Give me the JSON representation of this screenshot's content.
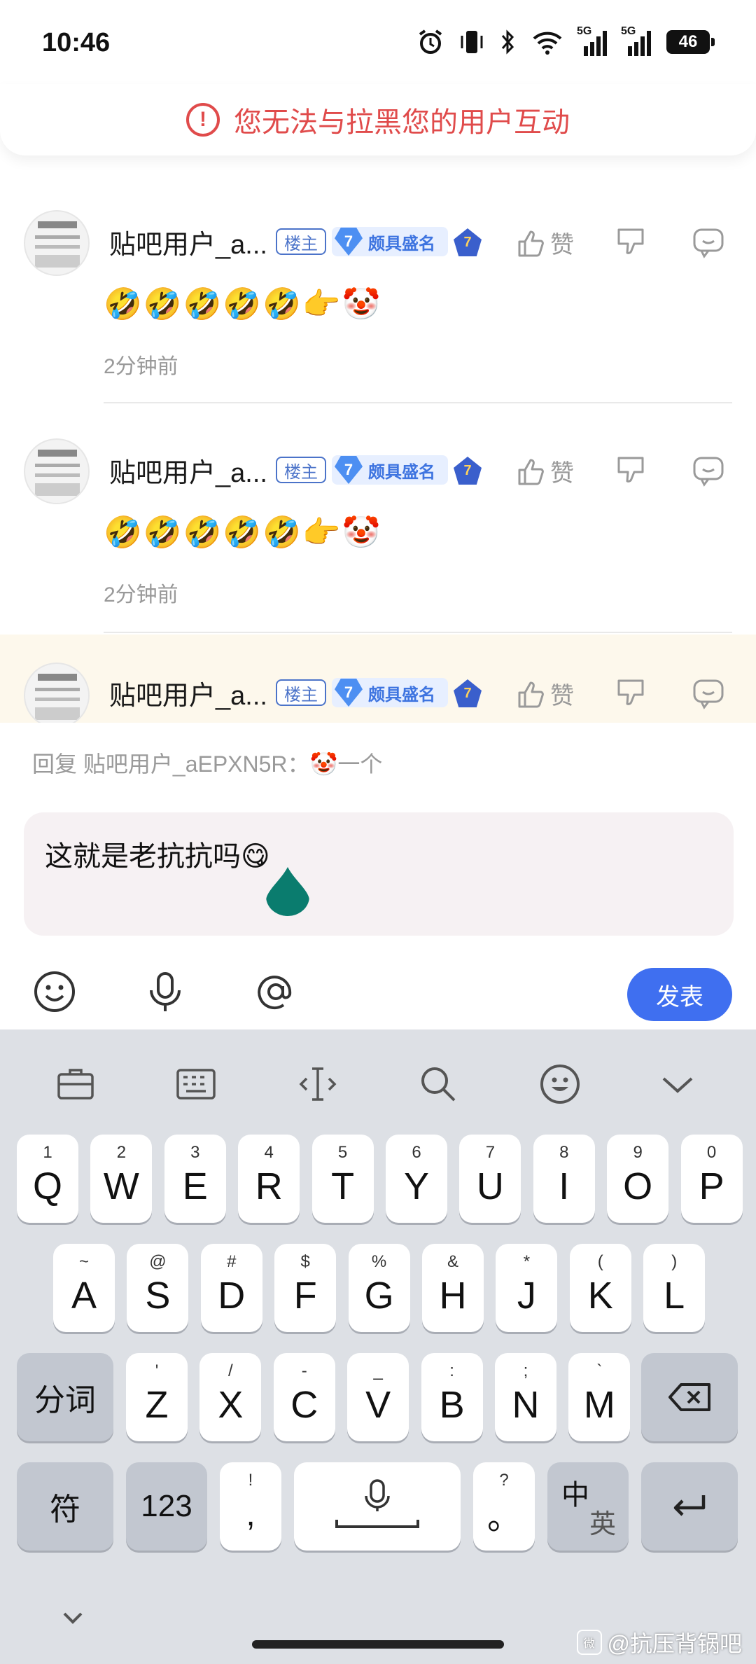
{
  "status_bar": {
    "time": "10:46",
    "network_1": "5G",
    "network_2": "5G",
    "battery": "46"
  },
  "banner": {
    "icon": "exclamation-circle-icon",
    "text": "您无法与拉黑您的用户互动",
    "color": "#e04b4b"
  },
  "comments": [
    {
      "username": "贴吧用户_a...",
      "host_tag": "楼主",
      "level": "7",
      "level_title": "颇具盛名",
      "medal": "7",
      "like_label": "赞",
      "body": "🤣🤣🤣🤣🤣👉🤡",
      "time": "2分钟前"
    },
    {
      "username": "贴吧用户_a...",
      "host_tag": "楼主",
      "level": "7",
      "level_title": "颇具盛名",
      "medal": "7",
      "like_label": "赞",
      "body": "🤣🤣🤣🤣🤣👉🤡",
      "time": "2分钟前"
    },
    {
      "username": "贴吧用户_a...",
      "host_tag": "楼主",
      "level": "7",
      "level_title": "颇具盛名",
      "medal": "7",
      "like_label": "赞"
    }
  ],
  "reply": {
    "hint": "回复 贴吧用户_aEPXN5R：🤡一个",
    "input_value": "这就是老抗抗吗😋",
    "publish_label": "发表",
    "accent": "#3f6ff0"
  },
  "keyboard": {
    "row1": [
      {
        "sub": "1",
        "main": "Q"
      },
      {
        "sub": "2",
        "main": "W"
      },
      {
        "sub": "3",
        "main": "E"
      },
      {
        "sub": "4",
        "main": "R"
      },
      {
        "sub": "5",
        "main": "T"
      },
      {
        "sub": "6",
        "main": "Y"
      },
      {
        "sub": "7",
        "main": "U"
      },
      {
        "sub": "8",
        "main": "I"
      },
      {
        "sub": "9",
        "main": "O"
      },
      {
        "sub": "0",
        "main": "P"
      }
    ],
    "row2": [
      {
        "sub": "~",
        "main": "A"
      },
      {
        "sub": "@",
        "main": "S"
      },
      {
        "sub": "#",
        "main": "D"
      },
      {
        "sub": "$",
        "main": "F"
      },
      {
        "sub": "%",
        "main": "G"
      },
      {
        "sub": "&",
        "main": "H"
      },
      {
        "sub": "*",
        "main": "J"
      },
      {
        "sub": "(",
        "main": "K"
      },
      {
        "sub": ")",
        "main": "L"
      }
    ],
    "row3": [
      {
        "sub": "'",
        "main": "Z"
      },
      {
        "sub": "/",
        "main": "X"
      },
      {
        "sub": "-",
        "main": "C"
      },
      {
        "sub": "_",
        "main": "V"
      },
      {
        "sub": ":",
        "main": "B"
      },
      {
        "sub": ";",
        "main": "N"
      },
      {
        "sub": "`",
        "main": "M"
      }
    ],
    "segment_label": "分词",
    "symbols_label": "符",
    "numbers_label": "123",
    "comma_sub": "!",
    "comma_main": ",",
    "period_sub": "?",
    "period_main": "。",
    "lang_main": "中",
    "lang_sub": "英"
  },
  "watermark": {
    "icon_text": "微",
    "text": "@抗压背锅吧"
  }
}
